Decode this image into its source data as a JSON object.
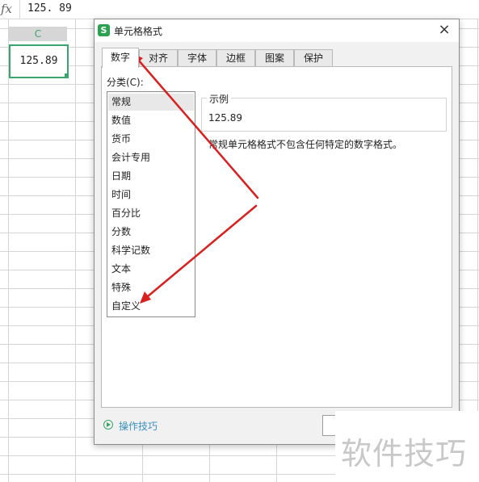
{
  "formula_bar": {
    "icon": "fx",
    "value": "125. 89"
  },
  "sheet": {
    "column_header": "C",
    "active_cell_value": "125.89"
  },
  "dialog": {
    "title": "单元格格式",
    "app_icon_letter": "S",
    "close_label": "×",
    "tabs": [
      {
        "label": "数字",
        "active": true
      },
      {
        "label": "对齐"
      },
      {
        "label": "字体"
      },
      {
        "label": "边框"
      },
      {
        "label": "图案"
      },
      {
        "label": "保护"
      }
    ],
    "category_label": "分类(C):",
    "categories": [
      "常规",
      "数值",
      "货币",
      "会计专用",
      "日期",
      "时间",
      "百分比",
      "分数",
      "科学记数",
      "文本",
      "特殊",
      "自定义"
    ],
    "selected_category": "常规",
    "sample_legend": "示例",
    "sample_value": "125.89",
    "description": "常规单元格格式不包含任何特定的数字格式。",
    "tips_label": "操作技巧"
  },
  "annotation": {
    "arrow_color": "#d9201f"
  },
  "watermark": {
    "text": "软件技巧"
  },
  "colors": {
    "accent_green": "#35a66c",
    "link_blue": "#3a8fc1"
  }
}
